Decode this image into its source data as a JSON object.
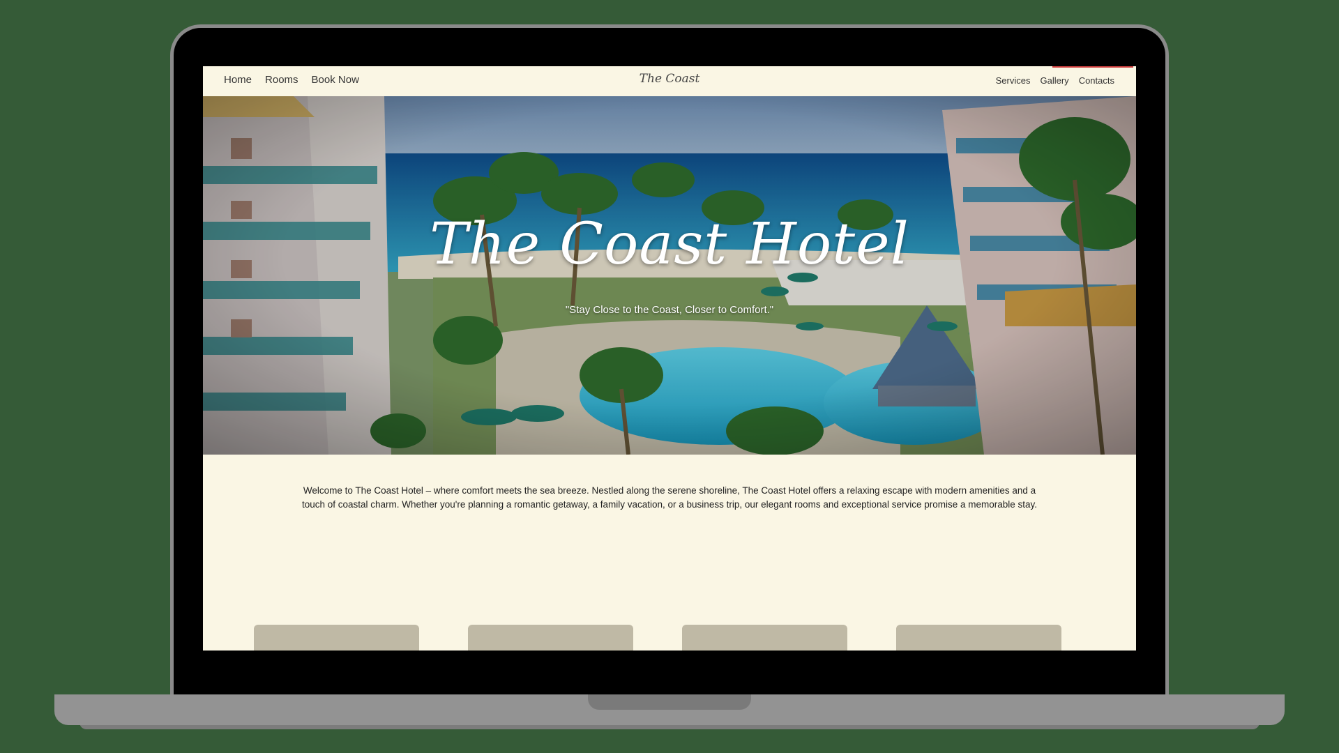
{
  "nav": {
    "left": [
      "Home",
      "Rooms",
      "Book Now"
    ],
    "brand": "The Coast",
    "right": [
      "Services",
      "Gallery",
      "Contacts"
    ]
  },
  "hero": {
    "title": "The Coast Hotel",
    "tagline": "\"Stay Close to the Coast, Closer to Comfort.\""
  },
  "intro": {
    "text": "Welcome to The Coast Hotel – where comfort meets the sea breeze. Nestled along the serene shoreline, The Coast Hotel offers a relaxing escape with modern amenities and a touch of coastal charm. Whether you're planning a romantic getaway, a family vacation, or a business trip, our elegant rooms and exceptional service promise a memorable stay."
  },
  "colors": {
    "page_background": "#355b37",
    "site_background": "#faf6e4",
    "card_color": "#bfb9a5",
    "accent": "#d24040"
  }
}
